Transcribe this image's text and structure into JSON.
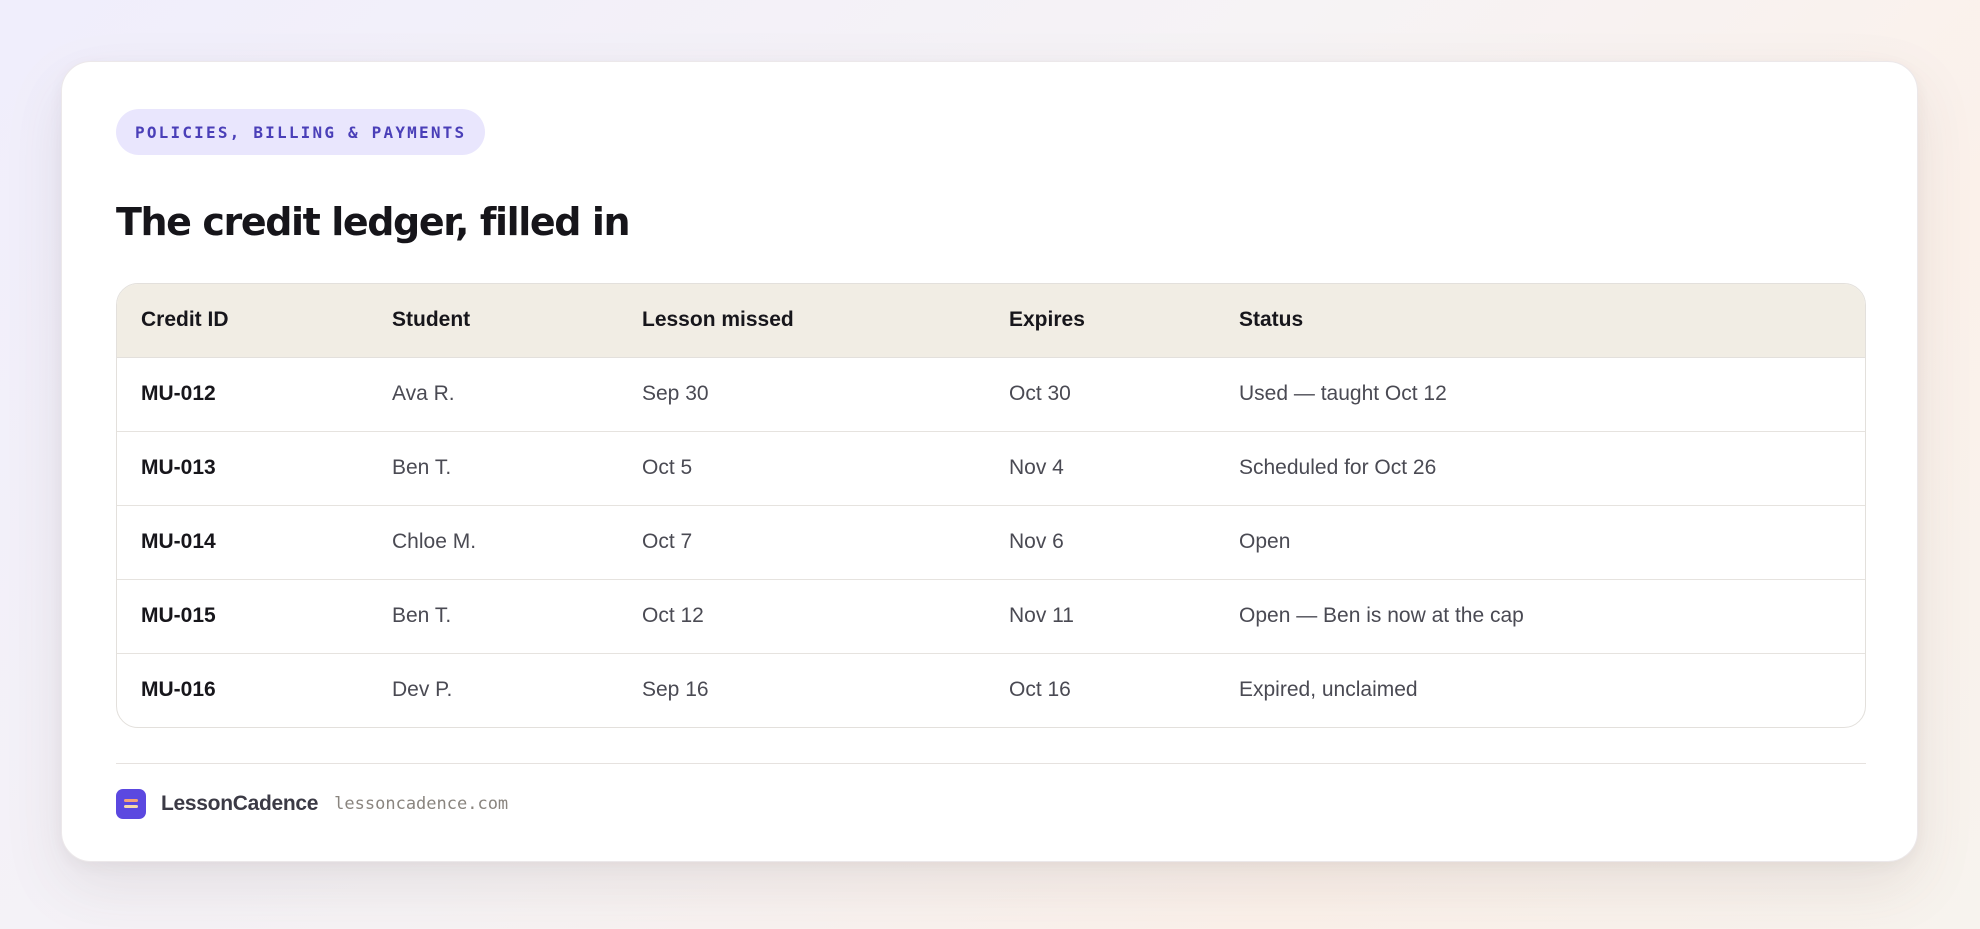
{
  "header": {
    "eyebrow": "POLICIES, BILLING & PAYMENTS",
    "title": "The credit ledger, filled in"
  },
  "table": {
    "columns": [
      "Credit ID",
      "Student",
      "Lesson missed",
      "Expires",
      "Status"
    ],
    "rows": [
      [
        "MU-012",
        "Ava R.",
        "Sep 30",
        "Oct 30",
        "Used — taught Oct 12"
      ],
      [
        "MU-013",
        "Ben T.",
        "Oct 5",
        "Nov 4",
        "Scheduled for Oct 26"
      ],
      [
        "MU-014",
        "Chloe M.",
        "Oct 7",
        "Nov 6",
        "Open"
      ],
      [
        "MU-015",
        "Ben T.",
        "Oct 12",
        "Nov 11",
        "Open — Ben is now at the cap"
      ],
      [
        "MU-016",
        "Dev P.",
        "Sep 16",
        "Oct 16",
        "Expired, unclaimed"
      ]
    ]
  },
  "footer": {
    "brand": "LessonCadence",
    "domain": "lessoncadence.com",
    "logo_icon": "lessoncadence-logo-icon"
  },
  "colors": {
    "accent": "#5b48e0",
    "pill_bg": "#e9e6fd",
    "pill_text": "#4a3fb8",
    "table_header_bg": "#f1ede4"
  }
}
